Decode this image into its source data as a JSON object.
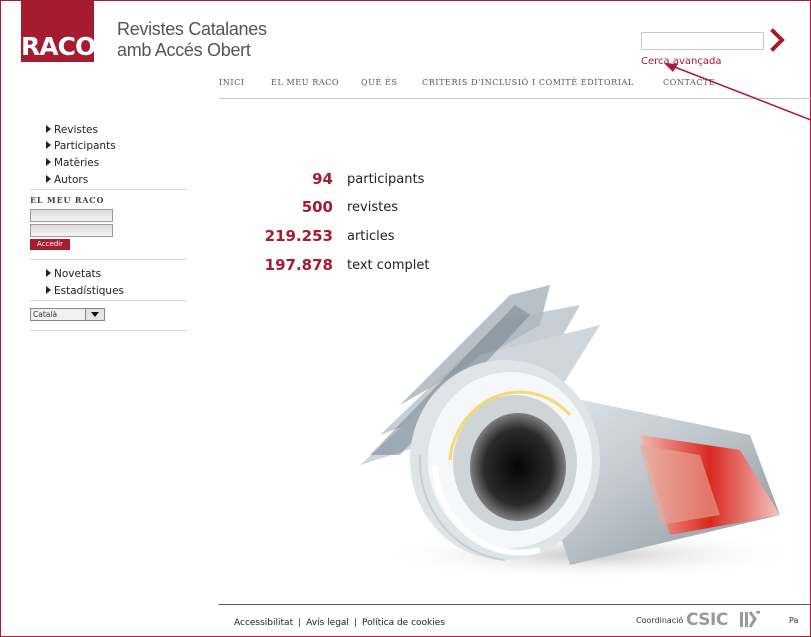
{
  "header": {
    "logo_text": "RACO",
    "site_title_line1": "Revistes Catalanes",
    "site_title_line2": "amb Accés Obert",
    "search_placeholder": "",
    "advanced_search_label": "Cerca avançada"
  },
  "topnav": {
    "items": [
      {
        "label": "INICI"
      },
      {
        "label": "EL MEU RACO"
      },
      {
        "label": "QUÈ ÉS"
      },
      {
        "label": "CRITERIS D'INCLUSIÓ I COMITÈ EDITORIAL"
      },
      {
        "label": "CONTACTE"
      }
    ]
  },
  "sidebar": {
    "main_items": [
      {
        "label": "Revistes"
      },
      {
        "label": "Participants"
      },
      {
        "label": "Matèries"
      },
      {
        "label": "Autors"
      }
    ],
    "login_heading": "EL MEU RACO",
    "login_button": "Accedir",
    "extra_items": [
      {
        "label": "Novetats"
      },
      {
        "label": "Estadístiques"
      }
    ],
    "language": "Català"
  },
  "stats": [
    {
      "value": "94",
      "label": "participants"
    },
    {
      "value": "500",
      "label": "revistes"
    },
    {
      "value": "219.253",
      "label": "articles"
    },
    {
      "value": "197.878",
      "label": "text complet"
    }
  ],
  "footer": {
    "links": [
      {
        "label": "Accessibilitat"
      },
      {
        "label": "Avís legal"
      },
      {
        "label": "Política de cookies"
      }
    ],
    "separator": "|",
    "coordination_label": "Coordinació",
    "partner_logo": "CSIC",
    "cutoff_text": "Pa"
  },
  "colors": {
    "brand": "#a51c30",
    "annotation_arrow": "#b0173a"
  },
  "icons": {
    "search_go": "chevron-right-icon",
    "list_bullet": "triangle-right-icon",
    "select_arrow": "chevron-down-icon"
  }
}
